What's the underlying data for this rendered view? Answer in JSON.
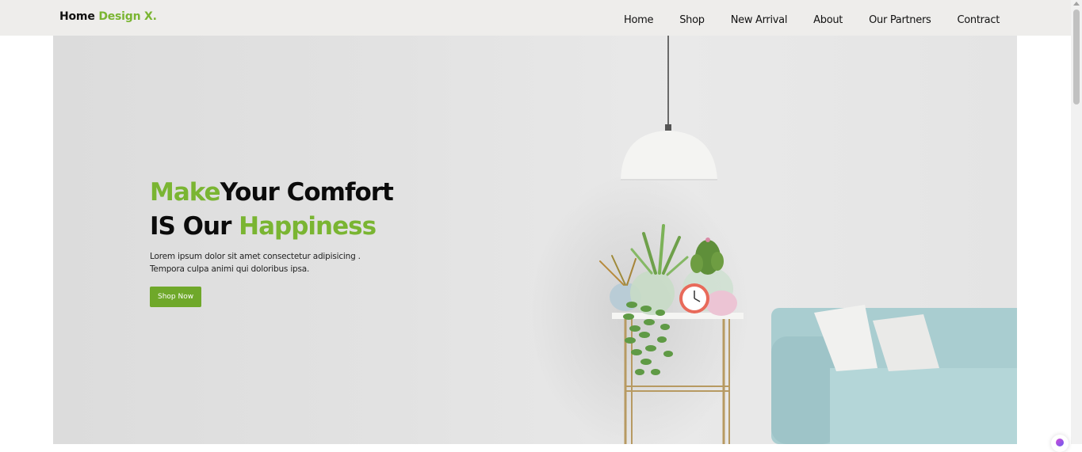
{
  "brand": {
    "name": "Home",
    "accent": "Design X."
  },
  "nav": {
    "items": [
      {
        "label": "Home"
      },
      {
        "label": "Shop"
      },
      {
        "label": "New Arrival"
      },
      {
        "label": "About"
      },
      {
        "label": "Our Partners"
      },
      {
        "label": "Contract"
      }
    ]
  },
  "hero": {
    "headline_line1_accent": "Make",
    "headline_line1_rest": "Your Comfort",
    "headline_line2_lead": "IS Our ",
    "headline_line2_accent": "Happiness",
    "subtext_line1": "Lorem ipsum dolor sit amet consectetur adipisicing .",
    "subtext_line2": "Tempora culpa animi qui doloribus ipsa.",
    "cta_label": "Shop Now"
  },
  "colors": {
    "accent": "#7ab532",
    "button": "#6fa82a",
    "navbar": "#eeedeb",
    "hero_background": "#e4e4e4",
    "sofa": "#a9cdd0",
    "lamp": "#f4f4f2",
    "side_table_gold": "#b79a62"
  },
  "icons": {
    "hero_image": "living-room-illustration",
    "floating_widget": "chat-widget-icon"
  }
}
